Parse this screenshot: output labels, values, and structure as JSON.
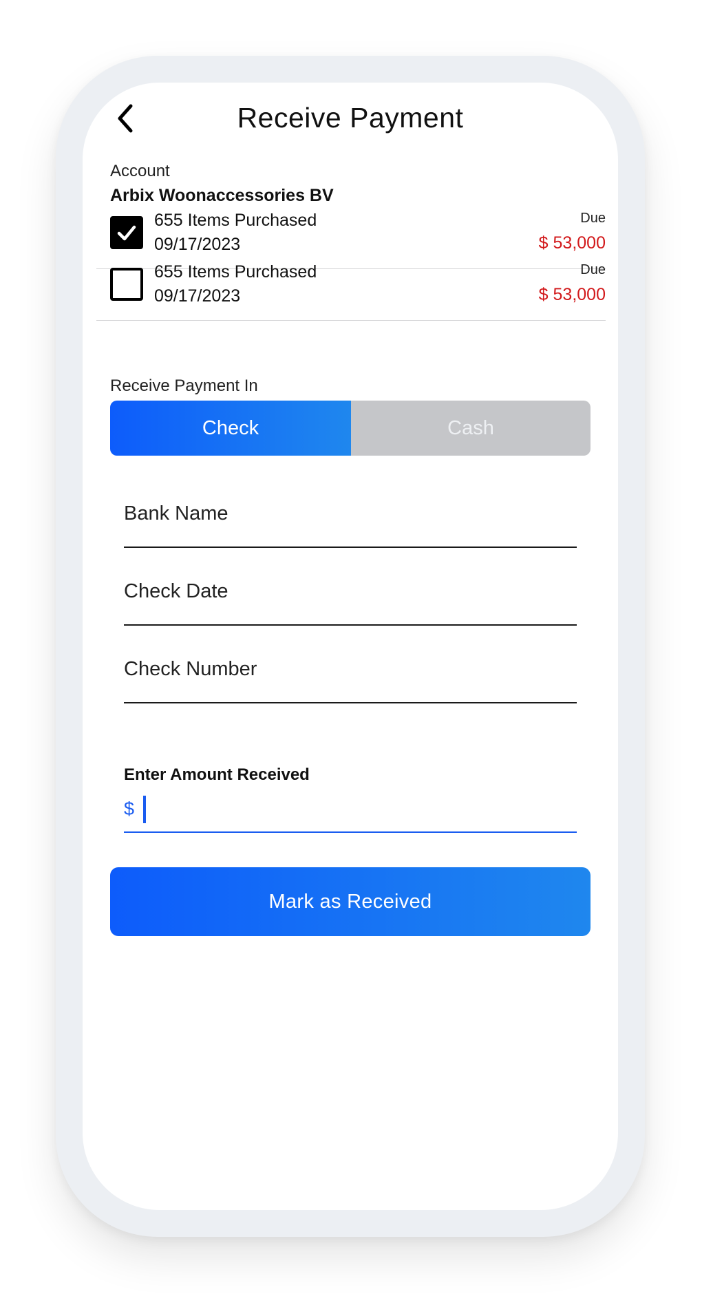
{
  "header": {
    "title": "Receive Payment",
    "back_icon": "chevron-left-icon"
  },
  "account": {
    "label": "Account",
    "name": "Arbix Woonaccessories BV"
  },
  "invoices": [
    {
      "title": "655 Items Purchased",
      "date": "09/17/2023",
      "due_label": "Due",
      "due_amount": "$ 53,000",
      "checked": true
    },
    {
      "title": "655 Items Purchased",
      "date": "09/17/2023",
      "due_label": "Due",
      "due_amount": "$ 53,000",
      "checked": false
    }
  ],
  "payment_method": {
    "label": "Receive Payment In",
    "options": [
      "Check",
      "Cash"
    ],
    "selected": "Check"
  },
  "fields": {
    "bank_name": "Bank Name",
    "check_date": "Check Date",
    "check_number": "Check Number"
  },
  "amount": {
    "label": "Enter Amount Received",
    "currency": "$",
    "value": ""
  },
  "submit_label": "Mark as Received",
  "colors": {
    "accent": "#0d5cfb",
    "accent_end": "#1f87ee",
    "due": "#d2191b",
    "segment_inactive": "#c5c6c9"
  }
}
